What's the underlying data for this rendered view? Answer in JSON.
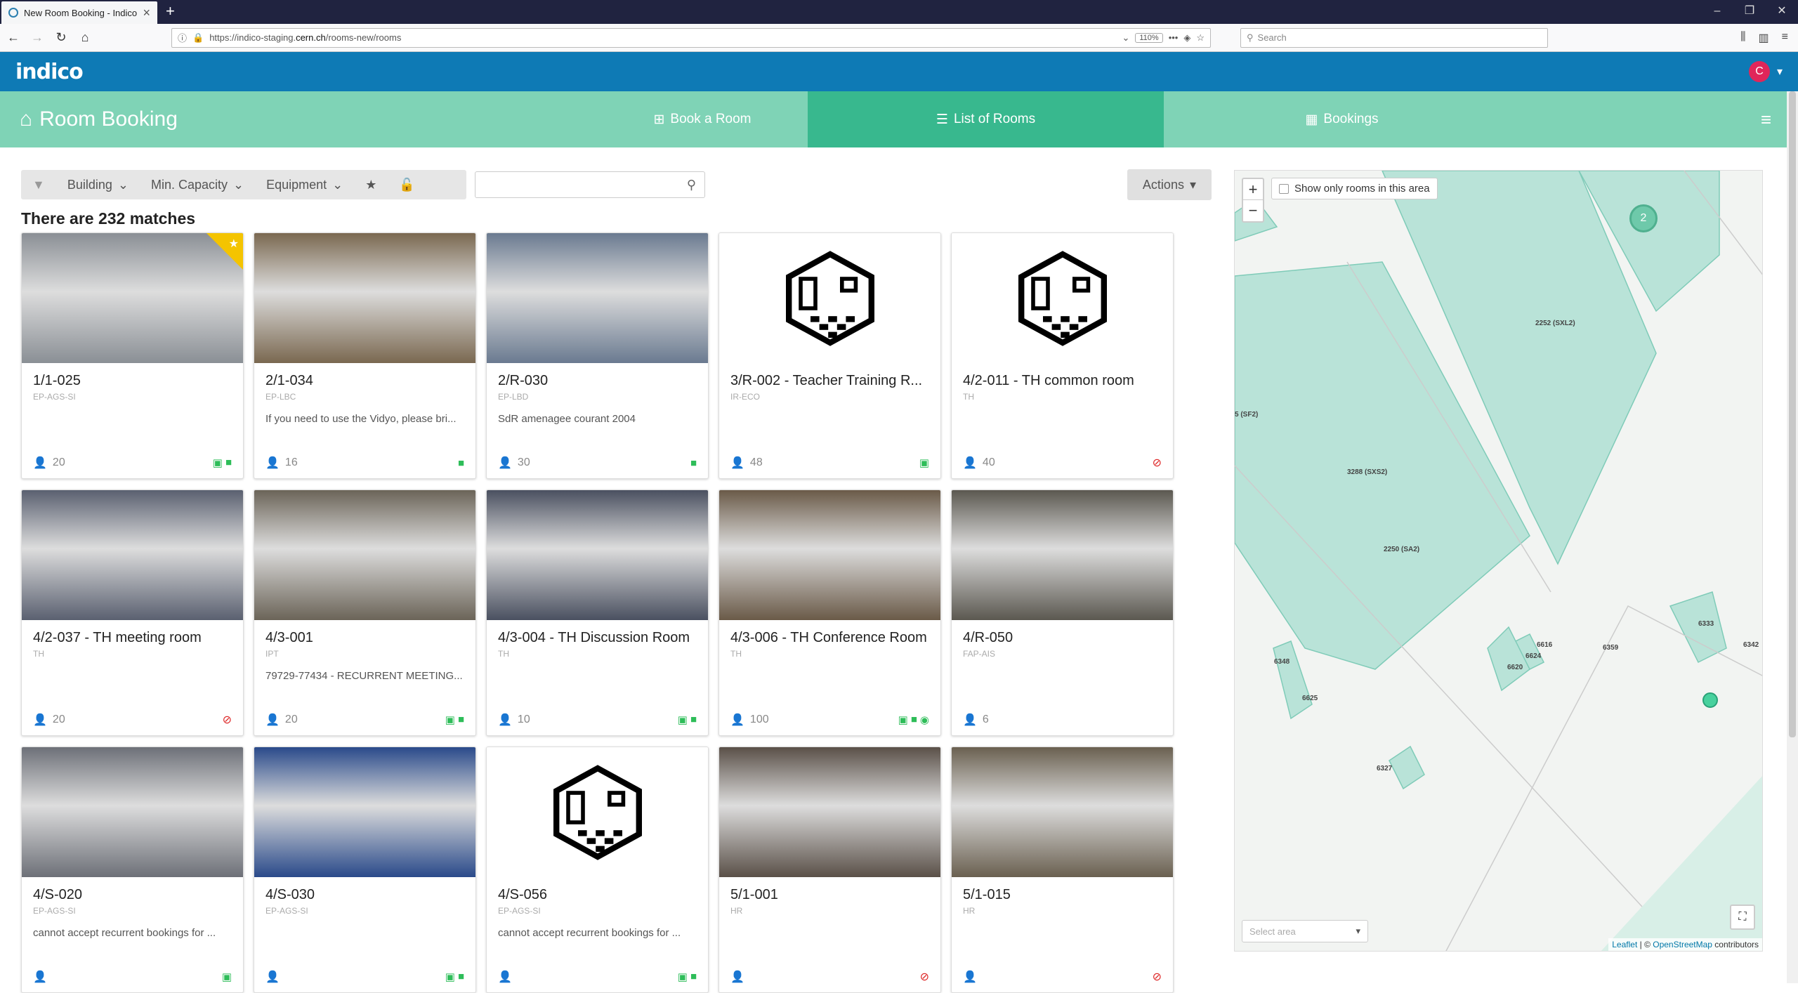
{
  "browser": {
    "tab_title": "New Room Booking - Indico",
    "url_prefix": "https://indico-staging.",
    "url_domain": "cern.ch",
    "url_path": "/rooms-new/rooms",
    "zoom": "110%",
    "search_placeholder": "Search"
  },
  "app": {
    "logo": "indico",
    "user_initial": "C"
  },
  "module": {
    "title": "Room Booking",
    "tabs": [
      {
        "label": "Book a Room"
      },
      {
        "label": "List of Rooms"
      },
      {
        "label": "Bookings"
      }
    ]
  },
  "filters": {
    "building": "Building",
    "min_capacity": "Min. Capacity",
    "equipment": "Equipment",
    "actions": "Actions"
  },
  "results": {
    "count_text": "There are 232 matches"
  },
  "rooms": [
    {
      "name": "1/1-025",
      "division": "EP-AGS-SI",
      "comment": "",
      "capacity": "20",
      "photo_color": "#8a8f95"
    },
    {
      "name": "2/1-034",
      "division": "EP-LBC",
      "comment": "If you need to use the Vidyo, please bri...",
      "capacity": "16",
      "photo_color": "#7a6850"
    },
    {
      "name": "2/R-030",
      "division": "EP-LBD",
      "comment": "SdR amenagee courant 2004",
      "capacity": "30",
      "photo_color": "#6a7a90"
    },
    {
      "name": "3/R-002 - Teacher Training R...",
      "division": "IR-ECO",
      "comment": "",
      "capacity": "48",
      "photo_color": "placeholder"
    },
    {
      "name": "4/2-011 - TH common room",
      "division": "TH",
      "comment": "",
      "capacity": "40",
      "photo_color": "placeholder"
    },
    {
      "name": "4/2-037 - TH meeting room",
      "division": "TH",
      "comment": "",
      "capacity": "20",
      "photo_color": "#5a6070"
    },
    {
      "name": "4/3-001",
      "division": "IPT",
      "comment": "79729-77434 - RECURRENT MEETING...",
      "capacity": "20",
      "photo_color": "#6b6458"
    },
    {
      "name": "4/3-004 - TH Discussion Room",
      "division": "TH",
      "comment": "",
      "capacity": "10",
      "photo_color": "#4a5060"
    },
    {
      "name": "4/3-006 - TH Conference Room",
      "division": "TH",
      "comment": "",
      "capacity": "100",
      "photo_color": "#6a5a48"
    },
    {
      "name": "4/R-050",
      "division": "FAP-AIS",
      "comment": "",
      "capacity": "6",
      "photo_color": "#5b5850"
    },
    {
      "name": "4/S-020",
      "division": "EP-AGS-SI",
      "comment": "cannot accept recurrent bookings for ...",
      "capacity": "",
      "photo_color": "#6d7078"
    },
    {
      "name": "4/S-030",
      "division": "EP-AGS-SI",
      "comment": "",
      "capacity": "",
      "photo_color": "#2a4a8a"
    },
    {
      "name": "4/S-056",
      "division": "EP-AGS-SI",
      "comment": "cannot accept recurrent bookings for ...",
      "capacity": "",
      "photo_color": "placeholder"
    },
    {
      "name": "5/1-001",
      "division": "HR",
      "comment": "",
      "capacity": "",
      "photo_color": "#5a5048"
    },
    {
      "name": "5/1-015",
      "division": "HR",
      "comment": "",
      "capacity": "",
      "photo_color": "#6a6050"
    }
  ],
  "map": {
    "checkbox_label": "Show only rooms in this area",
    "cluster_count": "2",
    "select_placeholder": "Select area",
    "attribution_leaflet": "Leaflet",
    "attribution_sep": " | © ",
    "attribution_osm": "OpenStreetMap",
    "attribution_suffix": " contributors",
    "labels": [
      {
        "text": "2252 (SXL2)"
      },
      {
        "text": "5 (SF2)"
      },
      {
        "text": "3288 (SXS2)"
      },
      {
        "text": "2250 (SA2)"
      },
      {
        "text": "6333"
      },
      {
        "text": "6342"
      },
      {
        "text": "6616"
      },
      {
        "text": "6624"
      },
      {
        "text": "6620"
      },
      {
        "text": "6359"
      },
      {
        "text": "6348"
      },
      {
        "text": "6625"
      },
      {
        "text": "6327"
      }
    ]
  },
  "colors": {
    "primary": "#0e7ab5",
    "module_bg": "#7fd3b6",
    "active_tab": "#38b88e",
    "favorite": "#f4c400"
  }
}
